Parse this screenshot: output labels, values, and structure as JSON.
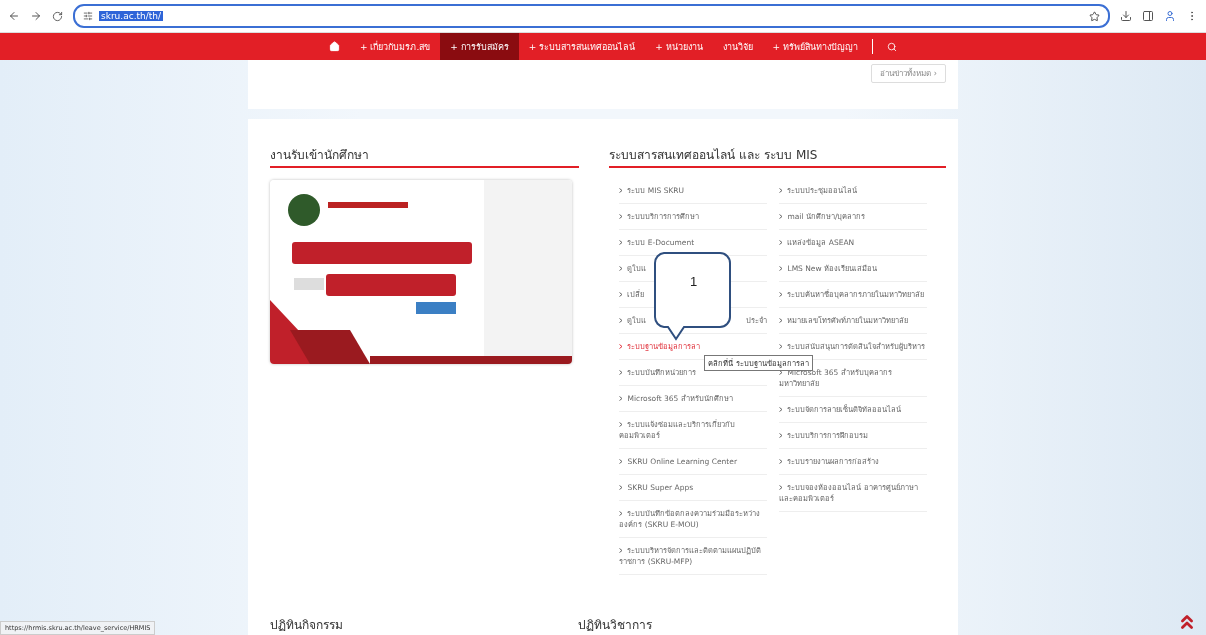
{
  "browser": {
    "url": "skru.ac.th/th/",
    "status_url": "https://hrmis.skru.ac.th/leave_service/HRMIS"
  },
  "nav": [
    {
      "kind": "home",
      "selected": false
    },
    {
      "kind": "link",
      "label": "+ เกี่ยวกับมรภ.สข",
      "selected": false
    },
    {
      "kind": "link",
      "label": "+ การรับสมัคร",
      "selected": true
    },
    {
      "kind": "link",
      "label": "+ ระบบสารสนเทศออนไลน์",
      "selected": false
    },
    {
      "kind": "link",
      "label": "+ หน่วยงาน",
      "selected": false
    },
    {
      "kind": "link",
      "label": "งานวิจัย",
      "selected": false
    },
    {
      "kind": "link",
      "label": "+ ทรัพย์สินทางปัญญา",
      "selected": false
    },
    {
      "kind": "search",
      "selected": false
    }
  ],
  "news_button": "อ่านข่าวทั้งหมด ›",
  "admission": {
    "title": "งานรับเข้านักศึกษา"
  },
  "systems": {
    "title": "ระบบสารสนเทศออนไลน์ และ ระบบ MIS",
    "columns": [
      [
        {
          "label": "ระบบ MIS SKRU",
          "hovered": false
        },
        {
          "label": "ระบบบริการการศึกษา",
          "hovered": false
        },
        {
          "label": "ระบบ E-Document",
          "hovered": false
        },
        {
          "label": "ดูใบแ",
          "hovered": false
        },
        {
          "label": "เปลี่ย",
          "hovered": false
        },
        {
          "label": "ดูใบแ",
          "tail": "ประจำ",
          "hovered": false
        },
        {
          "label": "ระบบฐานข้อมูลการลา",
          "hovered": true
        },
        {
          "label": "ระบบบันทึกหน่วยการ",
          "hovered": false
        },
        {
          "label": "Microsoft 365 สำหรับนักศึกษา",
          "hovered": false
        },
        {
          "label": "ระบบแจ้งซ่อมและบริการเกี่ยวกับคอมพิวเตอร์",
          "hovered": false
        },
        {
          "label": "SKRU Online Learning Center",
          "hovered": false
        },
        {
          "label": "SKRU Super Apps",
          "hovered": false
        },
        {
          "label": "ระบบบันทึกข้อตกลงความร่วมมือระหว่างองค์กร (SKRU E-MOU)",
          "hovered": false
        },
        {
          "label": "ระบบบริหารจัดการและติดตามแผนปฏิบัติราชการ (SKRU-MFP)",
          "hovered": false
        }
      ],
      [
        {
          "label": "ระบบประชุมออนไลน์",
          "hovered": false
        },
        {
          "label": "mail นักศึกษา/บุคลากร",
          "hovered": false
        },
        {
          "label": "แหล่งข้อมูล ASEAN",
          "hovered": false
        },
        {
          "label": "LMS New ห้องเรียนเสมือน",
          "hovered": false
        },
        {
          "label": "ระบบค้นหาชื่อบุคลากรภายในมหาวิทยาลัย",
          "hovered": false
        },
        {
          "label": "หมายเลขโทรศัพท์ภายในมหาวิทยาลัย",
          "hovered": false
        },
        {
          "label": "ระบบสนับสนุนการตัดสินใจสำหรับผู้บริหาร",
          "hovered": false
        },
        {
          "label": "Microsoft 365 สำหรับบุคลากรมหาวิทยาลัย",
          "hovered": false
        },
        {
          "label": "ระบบจัดการลายเซ็นดิจิทัลออนไลน์",
          "hovered": false
        },
        {
          "label": "ระบบบริการการฝึกอบรม",
          "hovered": false
        },
        {
          "label": "ระบบรายงานผลการก่อสร้าง",
          "hovered": false
        },
        {
          "label": "ระบบจองห้องออนไลน์ อาคารศูนย์ภาษาและคอมพิวเตอร์",
          "hovered": false
        }
      ]
    ],
    "callout": "1",
    "tooltip": "คลิกที่นี่ ระบบฐานข้อมูลการลา"
  },
  "bottom_headings": [
    "ปฏิทินกิจกรรม",
    "ปฏิทินวิชาการ"
  ]
}
